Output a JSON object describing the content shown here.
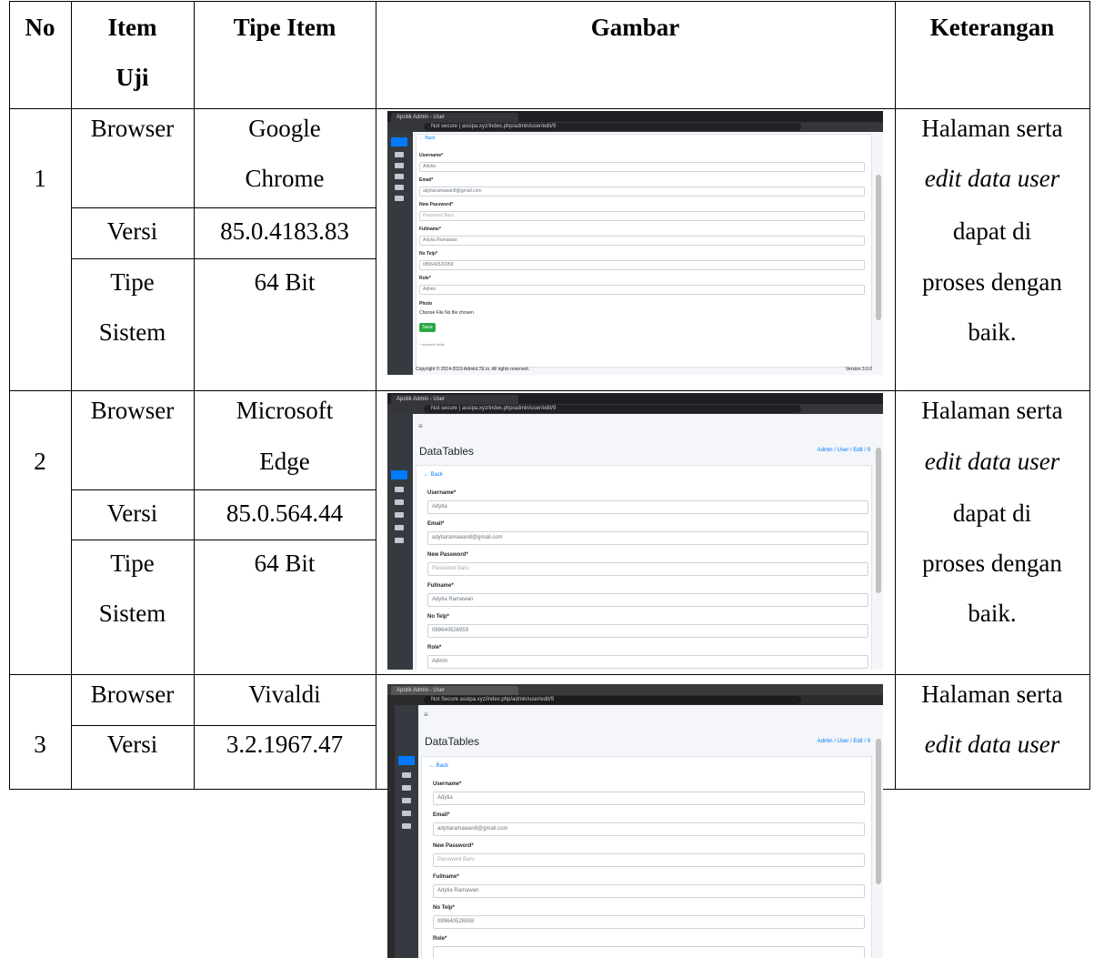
{
  "header": {
    "no": "No",
    "item_uji_1": "Item",
    "item_uji_2": "Uji",
    "tipe_item": "Tipe Item",
    "gambar": "Gambar",
    "keterangan": "Keterangan"
  },
  "rows": [
    {
      "no": "1",
      "browser_label": "Browser",
      "browser_value_1": "Google",
      "browser_value_2": "Chrome",
      "versi_label": "Versi",
      "versi_value": "85.0.4183.83",
      "tipe_label_1": "Tipe",
      "tipe_label_2": "Sistem",
      "tipe_value": "64 Bit",
      "ket": [
        "Halaman serta",
        "edit data user",
        "dapat di",
        "proses dengan",
        "baik."
      ]
    },
    {
      "no": "2",
      "browser_label": "Browser",
      "browser_value_1": "Microsoft",
      "browser_value_2": "Edge",
      "versi_label": "Versi",
      "versi_value": "85.0.564.44",
      "tipe_label_1": "Tipe",
      "tipe_label_2": "Sistem",
      "tipe_value": "64 Bit",
      "ket": [
        "Halaman serta",
        "edit data user",
        "dapat di",
        "proses dengan",
        "baik."
      ]
    },
    {
      "no": "3",
      "browser_label": "Browser",
      "browser_value_1": "Vivaldi",
      "versi_label": "Versi",
      "versi_value": "3.2.1967.47",
      "ket": [
        "Halaman serta",
        "edit data user"
      ]
    }
  ],
  "screens": {
    "s1": {
      "tab": "Apotik Admin - User",
      "url": "Not secure | assipa.xyz/index.php/admin/user/edit/9",
      "back": "← Back",
      "username_label": "Username*",
      "username_value": "Adytia",
      "email_label": "Email*",
      "email_value": "adytiaramawan8@gmail.com",
      "password_label": "New Password*",
      "password_placeholder": "Password Baru",
      "fullname_label": "Fullname*",
      "fullname_value": "Adytia Ramawan",
      "telp_label": "No Telp*",
      "telp_value": "089640526959",
      "role_label": "Role*",
      "role_value": "Admin",
      "photo_label": "Photo",
      "photo_value": "Choose File  No file chosen",
      "save": "Save",
      "required": "* required fields",
      "footer": "Copyright © 2014-2019 AdminLTE.io. All rights reserved.",
      "version": "Version 3.0.0"
    },
    "s2": {
      "tab": "Apotik Admin - User",
      "url": "Not secure | assipa.xyz/index.php/admin/user/edit/9",
      "title": "DataTables",
      "crumb": "Admin / User / Edit / 9",
      "back": "← Back",
      "username_label": "Username*",
      "username_value": "Adytia",
      "email_label": "Email*",
      "email_value": "adytiaramawan8@gmail.com",
      "password_label": "New Password*",
      "password_placeholder": "Password Baru",
      "fullname_label": "Fullname*",
      "fullname_value": "Adytia Ramawan",
      "telp_label": "No Telp*",
      "telp_value": "089640526959",
      "role_label": "Role*",
      "role_value": "Admin"
    },
    "s3": {
      "tab": "Apotik Admin - User",
      "url": "Not Secure  assipa.xyz/index.php/admin/user/edit/9",
      "title": "DataTables",
      "crumb": "Admin / User / Edit / 9",
      "back": "← Back",
      "username_label": "Username*",
      "username_value": "Adytia",
      "email_label": "Email*",
      "email_value": "adytiaramawan8@gmail.com",
      "password_label": "New Password*",
      "password_placeholder": "Password Baru",
      "fullname_label": "Fullname*",
      "fullname_value": "Adytia Ramawan",
      "telp_label": "No Telp*",
      "telp_value": "089640526959",
      "role_label": "Role*"
    }
  }
}
